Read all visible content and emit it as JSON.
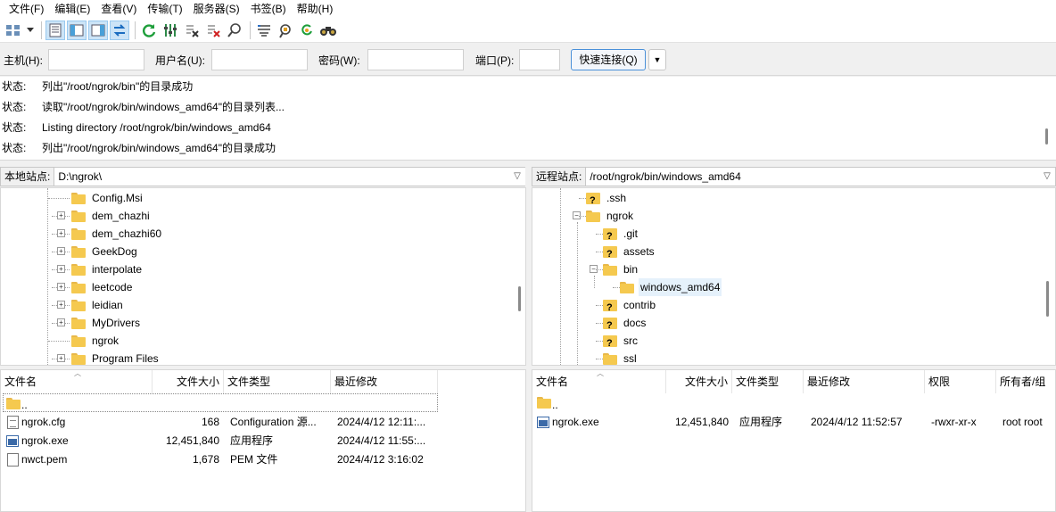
{
  "menu": [
    "文件(F)",
    "编辑(E)",
    "查看(V)",
    "传输(T)",
    "服务器(S)",
    "书签(B)",
    "帮助(H)"
  ],
  "toolbar_icons": [
    "site-manager-icon",
    "dropdown-arrow-icon",
    "message-log-icon",
    "local-tree-icon",
    "remote-tree-icon",
    "transfer-queue-icon",
    "refresh-icon",
    "process-queue-icon",
    "cancel-operation-icon",
    "disconnect-icon",
    "search-remote-icon",
    "filter-icon",
    "compare-icon",
    "sync-browse-icon",
    "binoculars-icon"
  ],
  "quickconnect": {
    "host_label": "主机(H):",
    "user_label": "用户名(U):",
    "pass_label": "密码(W):",
    "port_label": "端口(P):",
    "host_value": "",
    "user_value": "",
    "pass_value": "",
    "port_value": "",
    "button": "快速连接(Q)",
    "dropdown": "▼"
  },
  "log": [
    {
      "status": "状态:",
      "msg": "列出\"/root/ngrok/bin\"的目录成功"
    },
    {
      "status": "状态:",
      "msg": "读取\"/root/ngrok/bin/windows_amd64\"的目录列表..."
    },
    {
      "status": "状态:",
      "msg": "Listing directory /root/ngrok/bin/windows_amd64"
    },
    {
      "status": "状态:",
      "msg": "列出\"/root/ngrok/bin/windows_amd64\"的目录成功"
    }
  ],
  "local": {
    "site_label": "本地站点:",
    "path": "D:\\ngrok\\",
    "tree": [
      {
        "name": "Config.Msi",
        "exp": ""
      },
      {
        "name": "dem_chazhi",
        "exp": "+"
      },
      {
        "name": "dem_chazhi60",
        "exp": "+"
      },
      {
        "name": "GeekDog",
        "exp": "+"
      },
      {
        "name": "interpolate",
        "exp": "+"
      },
      {
        "name": "leetcode",
        "exp": "+"
      },
      {
        "name": "leidian",
        "exp": "+"
      },
      {
        "name": "MyDrivers",
        "exp": "+"
      },
      {
        "name": "ngrok",
        "exp": ""
      },
      {
        "name": "Program Files",
        "exp": "+"
      }
    ],
    "columns": [
      "文件名",
      "文件大小",
      "文件类型",
      "最近修改"
    ],
    "parent": "..",
    "files": [
      {
        "name": "ngrok.cfg",
        "size": "168",
        "type": "Configuration 源...",
        "modified": "2024/4/12 12:11:...",
        "icon": "text-file-icon"
      },
      {
        "name": "ngrok.exe",
        "size": "12,451,840",
        "type": "应用程序",
        "modified": "2024/4/12 11:55:...",
        "icon": "exe-file-icon"
      },
      {
        "name": "nwct.pem",
        "size": "1,678",
        "type": "PEM 文件",
        "modified": "2024/4/12 3:16:02",
        "icon": "blank-file-icon"
      }
    ]
  },
  "remote": {
    "site_label": "远程站点:",
    "path": "/root/ngrok/bin/windows_amd64",
    "tree": [
      {
        "name": ".ssh",
        "kind": "q",
        "depth": 1,
        "exp": ""
      },
      {
        "name": "ngrok",
        "kind": "f",
        "depth": 1,
        "exp": "−"
      },
      {
        "name": ".git",
        "kind": "q",
        "depth": 2,
        "exp": ""
      },
      {
        "name": "assets",
        "kind": "q",
        "depth": 2,
        "exp": ""
      },
      {
        "name": "bin",
        "kind": "f",
        "depth": 2,
        "exp": "−"
      },
      {
        "name": "windows_amd64",
        "kind": "f",
        "depth": 3,
        "exp": ""
      },
      {
        "name": "contrib",
        "kind": "q",
        "depth": 2,
        "exp": ""
      },
      {
        "name": "docs",
        "kind": "q",
        "depth": 2,
        "exp": ""
      },
      {
        "name": "src",
        "kind": "q",
        "depth": 2,
        "exp": ""
      },
      {
        "name": "ssl",
        "kind": "f",
        "depth": 2,
        "exp": ""
      }
    ],
    "columns": [
      "文件名",
      "文件大小",
      "文件类型",
      "最近修改",
      "权限",
      "所有者/组"
    ],
    "parent": "..",
    "files": [
      {
        "name": "ngrok.exe",
        "size": "12,451,840",
        "type": "应用程序",
        "modified": "2024/4/12 11:52:57",
        "perm": "-rwxr-xr-x",
        "owner": "root root"
      }
    ]
  }
}
